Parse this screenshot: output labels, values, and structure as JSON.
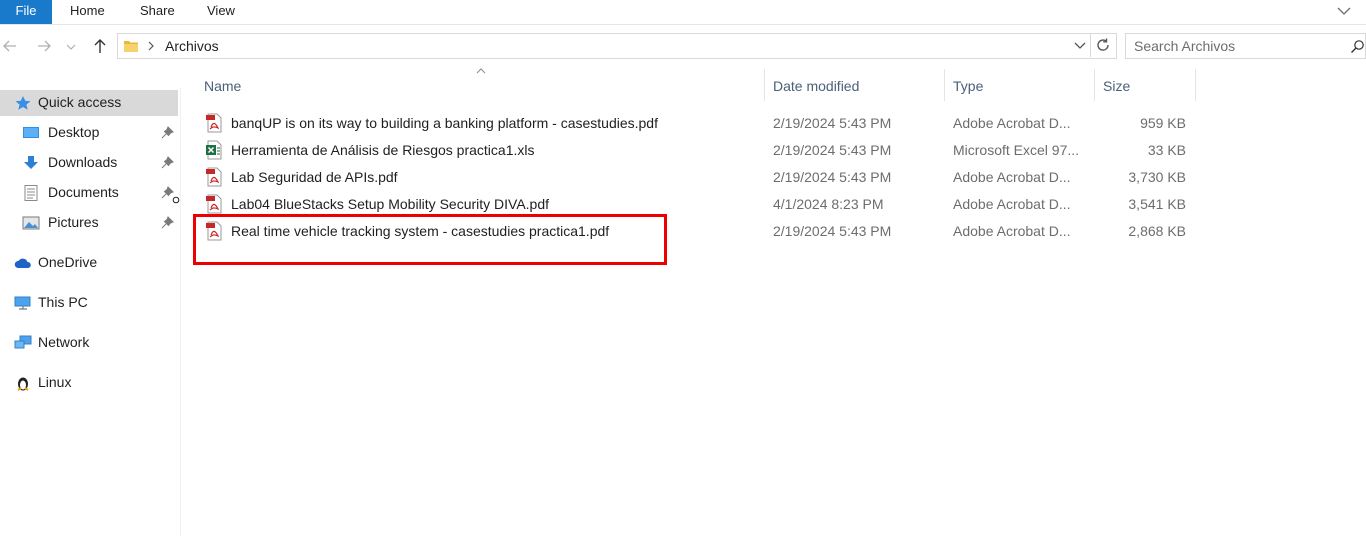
{
  "ribbon": {
    "tabs": [
      "File",
      "Home",
      "Share",
      "View"
    ]
  },
  "address": {
    "path": "Archivos",
    "search_placeholder": "Search Archivos"
  },
  "nav": {
    "quick_access": "Quick access",
    "pinned": [
      "Desktop",
      "Downloads",
      "Documents",
      "Pictures"
    ],
    "onedrive": "OneDrive",
    "thispc": "This PC",
    "network": "Network",
    "linux": "Linux"
  },
  "columns": {
    "name": "Name",
    "date": "Date modified",
    "type": "Type",
    "size": "Size"
  },
  "files": [
    {
      "name": "banqUP is on its way to building a banking platform - casestudies.pdf",
      "date": "2/19/2024 5:43 PM",
      "type": "Adobe Acrobat D...",
      "size": "959 KB",
      "icon": "pdf-icon"
    },
    {
      "name": "Herramienta de Análisis de Riesgos practica1.xls",
      "date": "2/19/2024 5:43 PM",
      "type": "Microsoft Excel 97...",
      "size": "33 KB",
      "icon": "excel-icon"
    },
    {
      "name": "Lab Seguridad de APIs.pdf",
      "date": "2/19/2024 5:43 PM",
      "type": "Adobe Acrobat D...",
      "size": "3,730 KB",
      "icon": "pdf-icon"
    },
    {
      "name": "Lab04 BlueStacks Setup Mobility Security DIVA.pdf",
      "date": "4/1/2024 8:23 PM",
      "type": "Adobe Acrobat D...",
      "size": "3,541 KB",
      "icon": "pdf-icon"
    },
    {
      "name": "Real time vehicle tracking system - casestudies practica1.pdf",
      "date": "2/19/2024 5:43 PM",
      "type": "Adobe Acrobat D...",
      "size": "2,868 KB",
      "icon": "pdf-icon"
    }
  ],
  "colors": {
    "file_tab": "#1979ca",
    "highlight": "#ee0000",
    "selection": "#cce8ff",
    "header_text": "#4c607a"
  }
}
